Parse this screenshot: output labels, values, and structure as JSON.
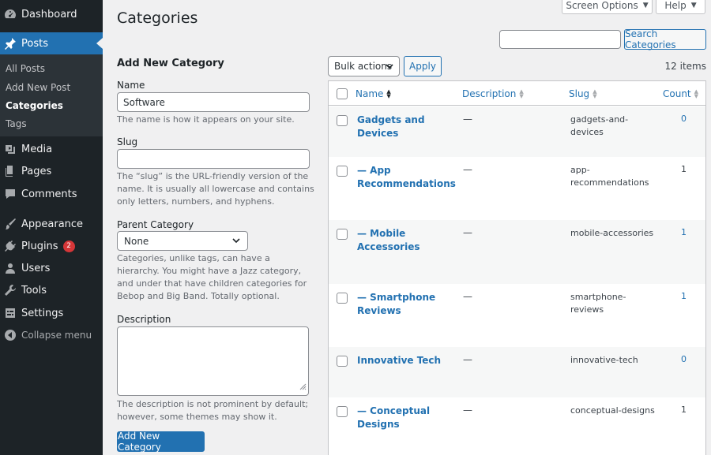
{
  "sidebar": {
    "items": [
      {
        "label": "Dashboard",
        "icon": "dashboard-icon"
      },
      {
        "label": "Posts",
        "icon": "pin-icon"
      },
      {
        "label": "Media",
        "icon": "media-icon"
      },
      {
        "label": "Pages",
        "icon": "pages-icon"
      },
      {
        "label": "Comments",
        "icon": "comments-icon"
      },
      {
        "label": "Appearance",
        "icon": "brush-icon"
      },
      {
        "label": "Plugins",
        "icon": "plugin-icon",
        "badge": "2"
      },
      {
        "label": "Users",
        "icon": "users-icon"
      },
      {
        "label": "Tools",
        "icon": "wrench-icon"
      },
      {
        "label": "Settings",
        "icon": "settings-icon"
      }
    ],
    "posts_submenu": [
      "All Posts",
      "Add New Post",
      "Categories",
      "Tags"
    ],
    "collapse_label": "Collapse menu"
  },
  "header": {
    "title": "Categories",
    "screen_options": "Screen Options",
    "help": "Help"
  },
  "search": {
    "value": "",
    "button_label": "Search Categories"
  },
  "form": {
    "heading": "Add New Category",
    "name_label": "Name",
    "name_value": "Software",
    "name_help": "The name is how it appears on your site.",
    "slug_label": "Slug",
    "slug_value": "",
    "slug_help": "The “slug” is the URL-friendly version of the name. It is usually all lowercase and contains only letters, numbers, and hyphens.",
    "parent_label": "Parent Category",
    "parent_value": "None",
    "parent_help": "Categories, unlike tags, can have a hierarchy. You might have a Jazz category, and under that have children categories for Bebop and Big Band. Totally optional.",
    "description_label": "Description",
    "description_value": "",
    "description_help": "The description is not prominent by default; however, some themes may show it.",
    "submit_label": "Add New Category"
  },
  "bulk": {
    "selected": "Bulk actions",
    "apply_label": "Apply",
    "items_count": "12 items"
  },
  "table": {
    "headers": {
      "name": "Name",
      "description": "Description",
      "slug": "Slug",
      "count": "Count"
    },
    "rows": [
      {
        "name": "Gadgets and Devices",
        "description": "—",
        "slug": "gadgets-and-devices",
        "count": "0"
      },
      {
        "name": "— App Recommendations",
        "description": "—",
        "slug": "app-recommendations",
        "count": "1"
      },
      {
        "name": "— Mobile Accessories",
        "description": "—",
        "slug": "mobile-accessories",
        "count": "1"
      },
      {
        "name": "— Smartphone Reviews",
        "description": "—",
        "slug": "smartphone-reviews",
        "count": "1"
      },
      {
        "name": "Innovative Tech",
        "description": "—",
        "slug": "innovative-tech",
        "count": "0"
      },
      {
        "name": "— Conceptual Designs",
        "description": "—",
        "slug": "conceptual-designs",
        "count": "1"
      }
    ]
  },
  "colors": {
    "sidebar_bg": "#1d2327",
    "accent": "#2271b1",
    "badge": "#d63638"
  }
}
